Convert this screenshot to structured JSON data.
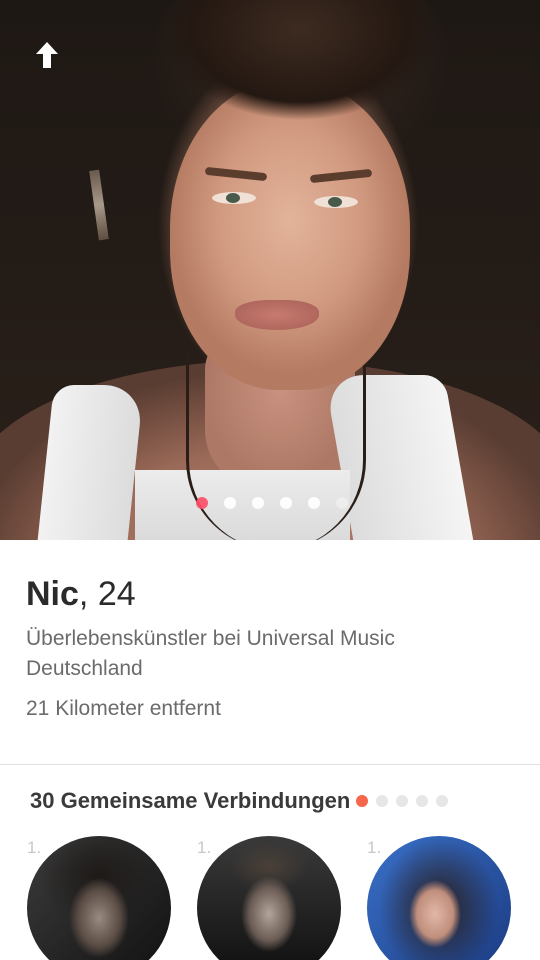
{
  "profile": {
    "name": "Nic",
    "age_text": ", 24",
    "job": "Überlebenskünstler bei Universal Music Deutschland",
    "distance": "21 Kilometer entfernt",
    "photo_count": 6,
    "active_photo_index": 0
  },
  "nav": {
    "back_icon": "arrow-up-icon"
  },
  "connections": {
    "title": "30 Gemeinsame Verbindungen",
    "page_count": 5,
    "active_page_index": 0,
    "items": [
      {
        "degree": "1."
      },
      {
        "degree": "1."
      },
      {
        "degree": "1."
      }
    ]
  },
  "colors": {
    "accent": "#fd5068",
    "connection_accent": "#f5664a"
  }
}
